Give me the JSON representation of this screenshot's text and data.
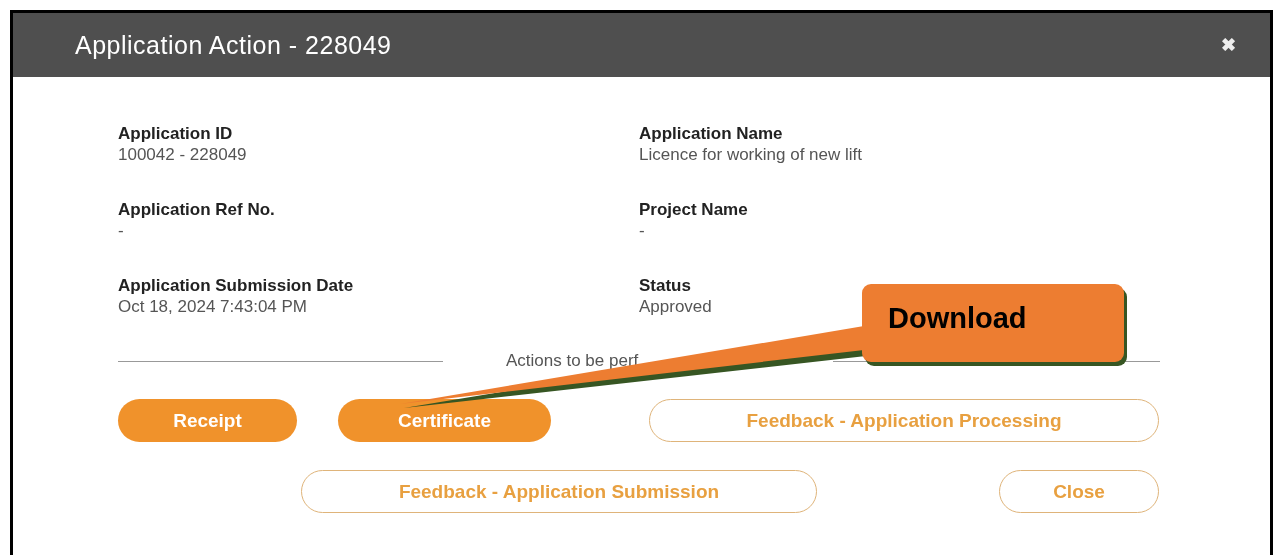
{
  "dialog": {
    "title": "Application Action - 228049",
    "close_icon": "✖"
  },
  "fields": [
    {
      "label": "Application ID",
      "value": "100042 - 228049"
    },
    {
      "label": "Application Name",
      "value": "Licence for working of new lift"
    },
    {
      "label": "Application Ref No.",
      "value": "-"
    },
    {
      "label": "Project Name",
      "value": "-"
    },
    {
      "label": "Application Submission Date",
      "value": "Oct 18, 2024 7:43:04 PM"
    },
    {
      "label": "Status",
      "value": "Approved"
    }
  ],
  "actions_heading": "Actions to be perf",
  "button_rows": [
    [
      {
        "label": "Receipt",
        "kind": "filled"
      },
      {
        "label": "Certificate",
        "kind": "filled"
      },
      {
        "label": "Feedback - Application Processing",
        "kind": "outline"
      }
    ],
    [
      {
        "label": "Feedback - Application Submission",
        "kind": "outline"
      },
      {
        "label": "Close",
        "kind": "outline"
      }
    ]
  ],
  "callout": {
    "text": "Download"
  }
}
